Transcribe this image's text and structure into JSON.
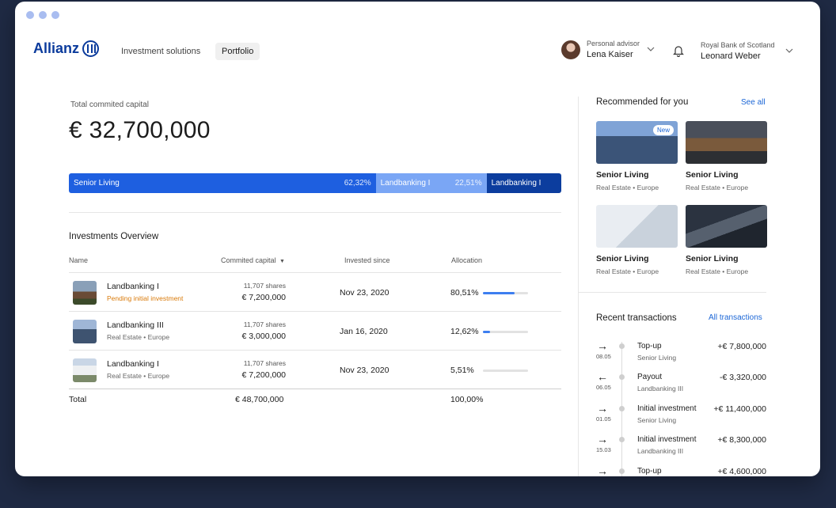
{
  "brand": {
    "name": "Allianz",
    "color": "#0b3b9c"
  },
  "nav": [
    {
      "label": "Investment solutions",
      "active": false
    },
    {
      "label": "Portfolio",
      "active": true
    }
  ],
  "advisor": {
    "role": "Personal advisor",
    "name": "Lena Kaiser"
  },
  "account": {
    "bank": "Royal Bank of Scotland",
    "name": "Leonard Weber"
  },
  "summary": {
    "label": "Total commited capital",
    "value": "€ 32,700,000",
    "allocation": [
      {
        "name": "Senior Living",
        "pct": "62,32%",
        "share": 62.32,
        "color": "#1e5fe0"
      },
      {
        "name": "Landbanking I",
        "pct": "22,51%",
        "share": 22.51,
        "color": "#7aa6f5"
      },
      {
        "name": "Landbanking I",
        "pct": "",
        "share": 15.17,
        "color": "#0c3d9e"
      }
    ]
  },
  "overview": {
    "title": "Investments Overview",
    "headers": {
      "name": "Name",
      "capital": "Commited capital",
      "since": "Invested since",
      "allocation": "Allocation"
    },
    "rows": [
      {
        "name": "Landbanking I",
        "sub": "Pending initial investment",
        "pending": true,
        "shares": "11,707 shares",
        "capital": "€ 7,200,000",
        "since": "Nov 23, 2020",
        "allocation": "80,51%",
        "fill": 0.7
      },
      {
        "name": "Landbanking III",
        "sub": "Real Estate • Europe",
        "pending": false,
        "shares": "11,707 shares",
        "capital": "€ 3,000,000",
        "since": "Jan 16, 2020",
        "allocation": "12,62%",
        "fill": 0.15
      },
      {
        "name": "Landbanking I",
        "sub": "Real Estate • Europe",
        "pending": false,
        "shares": "11,707 shares",
        "capital": "€ 7,200,000",
        "since": "Nov 23, 2020",
        "allocation": "5,51%",
        "fill": 0.0
      }
    ],
    "total": {
      "label": "Total",
      "capital": "€ 48,700,000",
      "allocation": "100,00%"
    }
  },
  "recommended": {
    "title": "Recommended for you",
    "see_all": "See all",
    "cards": [
      {
        "title": "Senior Living",
        "sub": "Real Estate • Europe",
        "badge": "New"
      },
      {
        "title": "Senior Living",
        "sub": "Real Estate • Europe",
        "badge": ""
      },
      {
        "title": "Senior Living",
        "sub": "Real Estate • Europe",
        "badge": ""
      },
      {
        "title": "Senior Living",
        "sub": "Real Estate • Europe",
        "badge": ""
      }
    ]
  },
  "transactions": {
    "title": "Recent transactions",
    "link": "All transactions",
    "items": [
      {
        "direction": "in",
        "date": "08.05",
        "title": "Top-up",
        "sub": "Senior Living",
        "amount": "+€ 7,800,000"
      },
      {
        "direction": "out",
        "date": "06.05",
        "title": "Payout",
        "sub": "Landbanking III",
        "amount": "-€ 3,320,000"
      },
      {
        "direction": "in",
        "date": "01.05",
        "title": "Initial investment",
        "sub": "Senior Living",
        "amount": "+€ 11,400,000"
      },
      {
        "direction": "in",
        "date": "15.03",
        "title": "Initial investment",
        "sub": "Landbanking III",
        "amount": "+€ 8,300,000"
      },
      {
        "direction": "in",
        "date": "",
        "title": "Top-up",
        "sub": "",
        "amount": "+€ 4,600,000"
      }
    ]
  },
  "icons": {
    "arrow_in": "→",
    "arrow_out": "←",
    "chevron": "chevron-down-icon",
    "bell": "bell-icon",
    "sort": "caret-down-icon"
  }
}
